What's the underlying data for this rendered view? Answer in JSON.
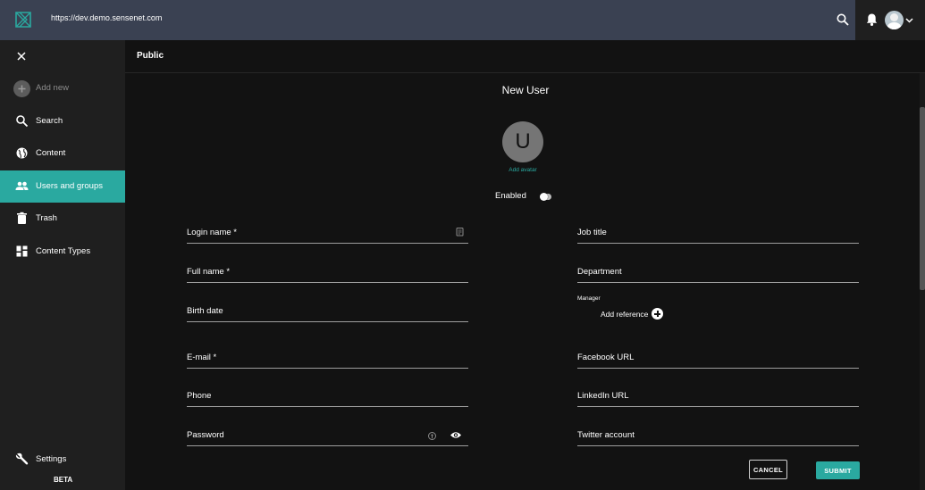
{
  "header": {
    "url": "https://dev.demo.sensenet.com",
    "icons": [
      "sensenet-logo",
      "search-icon",
      "bell-icon",
      "user-avatar",
      "chevron-down-icon"
    ]
  },
  "sidebar": {
    "close_icon": "close-icon",
    "items": [
      {
        "label": "Add new",
        "icon": "add-circle-icon",
        "active": false
      },
      {
        "label": "Search",
        "icon": "search-icon",
        "active": false
      },
      {
        "label": "Content",
        "icon": "globe-icon",
        "active": false
      },
      {
        "label": "Users and groups",
        "icon": "people-icon",
        "active": true
      },
      {
        "label": "Trash",
        "icon": "trash-icon",
        "active": false
      },
      {
        "label": "Content Types",
        "icon": "widgets-icon",
        "active": false
      },
      {
        "label": "Settings",
        "icon": "wrench-icon",
        "active": false
      }
    ],
    "beta": "BETA"
  },
  "breadcrumb": {
    "current": "Public"
  },
  "form": {
    "title": "New User",
    "avatar_letter": "U",
    "add_avatar": "Add avatar",
    "enabled_label": "Enabled",
    "enabled": false,
    "left_fields": [
      {
        "label": "Login name *",
        "value": ""
      },
      {
        "label": "Full name *",
        "value": ""
      },
      {
        "label": "Birth date",
        "value": ""
      },
      {
        "label": "E-mail *",
        "value": ""
      },
      {
        "label": "Phone",
        "value": ""
      },
      {
        "label": "Password",
        "value": ""
      }
    ],
    "right_fields": [
      {
        "label": "Job title",
        "value": ""
      },
      {
        "label": "Department",
        "value": ""
      },
      {
        "label": "Facebook URL",
        "value": ""
      },
      {
        "label": "LinkedIn URL",
        "value": ""
      },
      {
        "label": "Twitter account",
        "value": ""
      }
    ],
    "manager": {
      "label": "Manager",
      "add_reference": "Add reference"
    },
    "buttons": {
      "cancel": "CANCEL",
      "submit": "SUBMIT"
    }
  },
  "colors": {
    "accent": "#2aa9a0",
    "topbar": "#3a4152",
    "sidebar": "#1f1f1f",
    "background": "#121212"
  }
}
